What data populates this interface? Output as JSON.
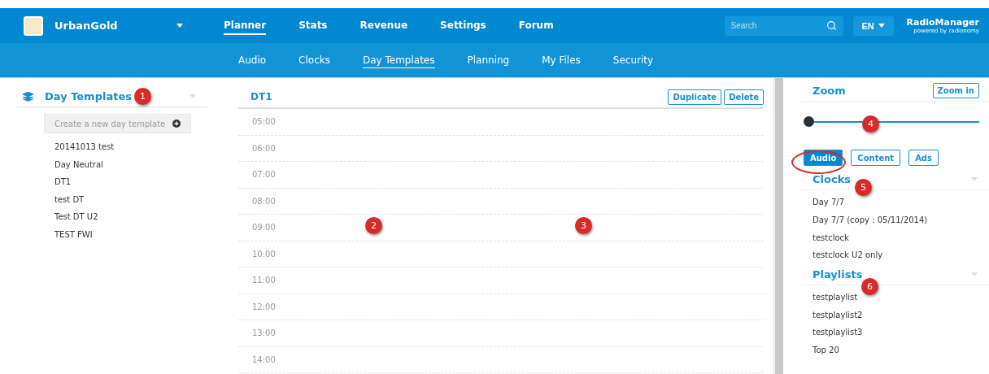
{
  "topbar": {
    "station": "UrbanGold",
    "nav": [
      {
        "label": "Planner",
        "selected": true
      },
      {
        "label": "Stats",
        "selected": false
      },
      {
        "label": "Revenue",
        "selected": false
      },
      {
        "label": "Settings",
        "selected": false
      },
      {
        "label": "Forum",
        "selected": false
      }
    ],
    "search": {
      "placeholder": "Search"
    },
    "language": "EN",
    "brand": "RadioManager",
    "brand_tagline": "powered by radionomy"
  },
  "subnav": [
    {
      "label": "Audio",
      "selected": false
    },
    {
      "label": "Clocks",
      "selected": false
    },
    {
      "label": "Day Templates",
      "selected": true
    },
    {
      "label": "Planning",
      "selected": false
    },
    {
      "label": "My Files",
      "selected": false
    },
    {
      "label": "Security",
      "selected": false
    }
  ],
  "sidebar": {
    "title": "Day Templates",
    "create_button": "Create a new day template",
    "items": [
      "20141013 test",
      "Day Neutral",
      "DT1",
      "test DT",
      "Test DT U2",
      "TEST FWI"
    ]
  },
  "editor": {
    "title": "DT1",
    "buttons": [
      "Duplicate",
      "Delete"
    ],
    "hours": [
      "05:00",
      "06:00",
      "07:00",
      "08:00",
      "09:00",
      "10:00",
      "11:00",
      "12:00",
      "13:00",
      "14:00"
    ]
  },
  "right_panel": {
    "zoom_title": "Zoom",
    "zoom_button": "Zoom in",
    "zoom_slider": {
      "level": 0
    },
    "filters": [
      {
        "label": "Audio",
        "selected": true
      },
      {
        "label": "Content",
        "selected": false
      },
      {
        "label": "Ads",
        "selected": false
      }
    ],
    "clocks_title": "Clocks",
    "clocks": [
      "Day 7/7",
      "Day 7/7 (copy : 05/11/2014)",
      "testclock",
      "testclock U2 only"
    ],
    "playlists_title": "Playlists",
    "playlists": [
      "testplaylist",
      "testplaylist2",
      "testplaylist3",
      "Top 20"
    ]
  },
  "callouts": [
    "1",
    "2",
    "3",
    "4",
    "5",
    "6"
  ]
}
